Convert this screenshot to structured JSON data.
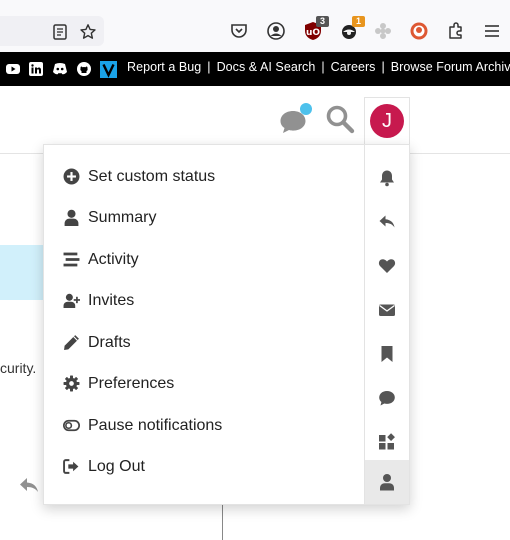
{
  "site_links": {
    "items": [
      "Report a Bug",
      "Docs & AI Search",
      "Careers",
      "Browse Forum Archive"
    ],
    "separator": "|"
  },
  "browser_toolbar": {
    "ublock_badge": "3",
    "ext_badge": "1"
  },
  "header": {
    "avatar_letter": "J",
    "avatar_color": "#c7194e",
    "chat_indicator_color": "#4dc1ec"
  },
  "background": {
    "text_fragment": "curity."
  },
  "user_menu": {
    "items": [
      {
        "label": "Set custom status",
        "icon": "plus-circle-icon"
      },
      {
        "label": "Summary",
        "icon": "user-icon"
      },
      {
        "label": "Activity",
        "icon": "stream-icon"
      },
      {
        "label": "Invites",
        "icon": "user-plus-icon"
      },
      {
        "label": "Drafts",
        "icon": "pencil-icon"
      },
      {
        "label": "Preferences",
        "icon": "cog-icon"
      },
      {
        "label": "Pause notifications",
        "icon": "toggle-off-icon"
      },
      {
        "label": "Log Out",
        "icon": "sign-out-icon"
      }
    ],
    "tabs": [
      "bell-icon",
      "reply-icon",
      "heart-icon",
      "envelope-icon",
      "bookmark-icon",
      "chat-bubble-icon",
      "widgets-icon",
      "user-icon"
    ],
    "active_tab": 7
  }
}
